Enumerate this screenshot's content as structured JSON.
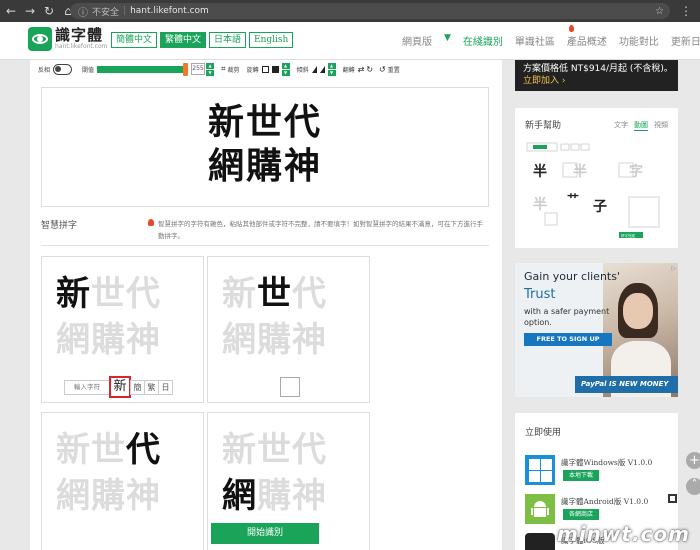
{
  "browser": {
    "back_icon": "arrow-left-icon",
    "forward_icon": "arrow-right-icon",
    "reload_icon": "reload-icon",
    "home_icon": "home-icon",
    "insecure_label": "不安全",
    "url": "hant.likefont.com"
  },
  "header": {
    "logo_title": "識字體",
    "logo_url": "hant.likefont.com",
    "lang_tabs": [
      {
        "label": "簡體中文"
      },
      {
        "label": "繁體中文"
      },
      {
        "label": "日本語"
      },
      {
        "label": "English"
      }
    ],
    "nav": [
      "網頁版",
      "在綫識別",
      "單識社區",
      "產品概述",
      "功能對比",
      "更新日誌"
    ]
  },
  "toolbar": {
    "outline_label": "反相",
    "threshold_label": "閾值",
    "threshold_value": "255",
    "threshold_fraction": 0.98,
    "crop_label": "裁剪",
    "rotate_label": "旋轉",
    "skew_label": "傾斜",
    "flip_label": "翻轉",
    "reset_label": "重置"
  },
  "preview": {
    "line1": "新世代",
    "line2": "網購神"
  },
  "smart": {
    "label": "智慧拼字",
    "description": "智慧拼字的字符有雜色，粘貼其他部件或字符不完整，請不要填字！如對智慧拼字的結果不滿意，可在下方進行手動拼字。"
  },
  "cards": [
    {
      "chars": [
        "新",
        "世",
        "代",
        "網",
        "購",
        "神"
      ],
      "highlight": 0,
      "input_placeholder": "輸入字符",
      "selected_char": "新",
      "alt_chars": [
        "簡",
        "繁",
        "日"
      ]
    },
    {
      "chars": [
        "新",
        "世",
        "代",
        "網",
        "購",
        "神"
      ],
      "highlight": 1
    },
    {
      "chars": [
        "新",
        "世",
        "代",
        "網",
        "購",
        "神"
      ],
      "highlight": 2
    },
    {
      "chars": [
        "新",
        "世",
        "代",
        "網",
        "購",
        "神"
      ],
      "highlight": 3
    }
  ],
  "start_button": "開始識別",
  "sidebar": {
    "promo_line1": "方案價格低 NT$914/月起 (不含稅)。",
    "promo_link": "立即加入 ›",
    "help_title": "新手幫助",
    "help_tabs": [
      "文字",
      "動圖",
      "視頻"
    ],
    "help_diagram_button": "拼字完成",
    "help_chars": [
      "半",
      "字",
      "艹",
      "子"
    ],
    "ad": {
      "title": "Gain your clients'",
      "title2": "Trust",
      "text": "with a safer payment option.",
      "button": "FREE TO SIGN UP",
      "paypal": "PayPal IS NEW MONEY"
    },
    "use_title": "立即使用",
    "apps": [
      {
        "name": "識字體Windows版 V1.0.0",
        "button": "本地下載",
        "icon": "windows-icon"
      },
      {
        "name": "識字體Android版 V1.0.0",
        "button": "各網商店",
        "icon": "android-icon"
      },
      {
        "name": "識字體iOS版",
        "button": "",
        "icon": "apple-icon"
      }
    ]
  },
  "watermark": "minwt.com"
}
